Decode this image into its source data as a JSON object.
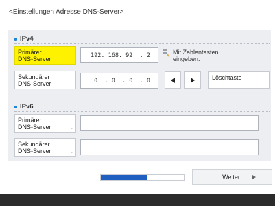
{
  "title": "<Einstellungen Adresse DNS-Server>",
  "ipv4": {
    "header": "IPv4",
    "primary_label_1": "Primärer",
    "primary_label_2": "DNS-Server",
    "primary_value": "192. 168. 92  . 2",
    "secondary_label_1": "Sekundärer",
    "secondary_label_2": "DNS-Server",
    "secondary_value": " 0  . 0  . 0  . 0",
    "hint_1": "Mit Zahlentasten",
    "hint_2": "eingeben.",
    "delete_label": "Löschtaste"
  },
  "ipv6": {
    "header": "IPv6",
    "primary_label_1": "Primärer",
    "primary_label_2": "DNS-Server",
    "primary_value": "",
    "secondary_label_1": "Sekundärer",
    "secondary_label_2": "DNS-Server",
    "secondary_value": ""
  },
  "corner_mark": ",",
  "progress_percent": 55,
  "next_label": "Weiter",
  "colors": {
    "active": "#fff200",
    "accent": "#1e86d4",
    "progress": "#1f5fbf"
  }
}
